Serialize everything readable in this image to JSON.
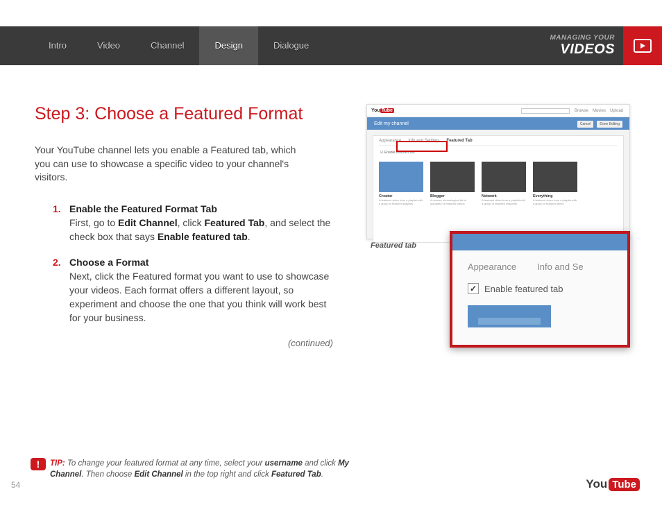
{
  "header": {
    "nav": [
      "Intro",
      "Video",
      "Channel",
      "Design",
      "Dialogue"
    ],
    "active_index": 3,
    "section_small": "MANAGING YOUR",
    "section_big": "VIDEOS"
  },
  "title": "Step 3: Choose a Featured Format",
  "intro": "Your YouTube channel lets you enable a Featured tab, which you can use to showcase a specific video to your channel's visitors.",
  "steps": [
    {
      "num": "1.",
      "title": "Enable the Featured Format Tab",
      "body_html": "First, go to <b>Edit Channel</b>, click <b>Featured Tab</b>, and select the check box that says <b>Enable featured tab</b>."
    },
    {
      "num": "2.",
      "title": "Choose a Format",
      "body_html": "Next, click the Featured format you want to use to showcase your videos. Each format offers a different layout, so experiment and choose the one that you think will work best for your business."
    }
  ],
  "continued": "(continued)",
  "tip": {
    "label": "TIP:",
    "body_html": " To change your featured format at any time, select your <b>username</b> and click <b>My Channel</b>. Then choose <b>Edit Channel</b> in the top right and click <b>Featured Tab</b>."
  },
  "page_number": "54",
  "logo": {
    "you": "You",
    "tube": "Tube"
  },
  "screenshot": {
    "caption": "Featured tab",
    "topbar": {
      "logo_you": "You",
      "logo_tube": "Tube",
      "links": [
        "Browse",
        "Movies",
        "Upload"
      ]
    },
    "bluebar_title": "Edit my channel",
    "bluebar_buttons": [
      "Cancel",
      "Done Editing"
    ],
    "tabs": [
      "Appearance",
      "Info and Settings",
      "Featured Tab"
    ],
    "checkbox_label": "Enable featured tab",
    "formats": [
      {
        "name": "Creator",
        "desc": "A featured video from a playlist with a group of featured playlists"
      },
      {
        "name": "Blogger",
        "desc": "A reverse chronological list of uploaded or featured videos"
      },
      {
        "name": "Network",
        "desc": "A featured video from a playlist with a group of featured channels"
      },
      {
        "name": "Everything",
        "desc": "A featured video from a playlist with a group of featured items"
      }
    ],
    "zoom": {
      "tab1": "Appearance",
      "tab2": "Info and Se",
      "checkbox_label": "Enable featured tab"
    }
  }
}
